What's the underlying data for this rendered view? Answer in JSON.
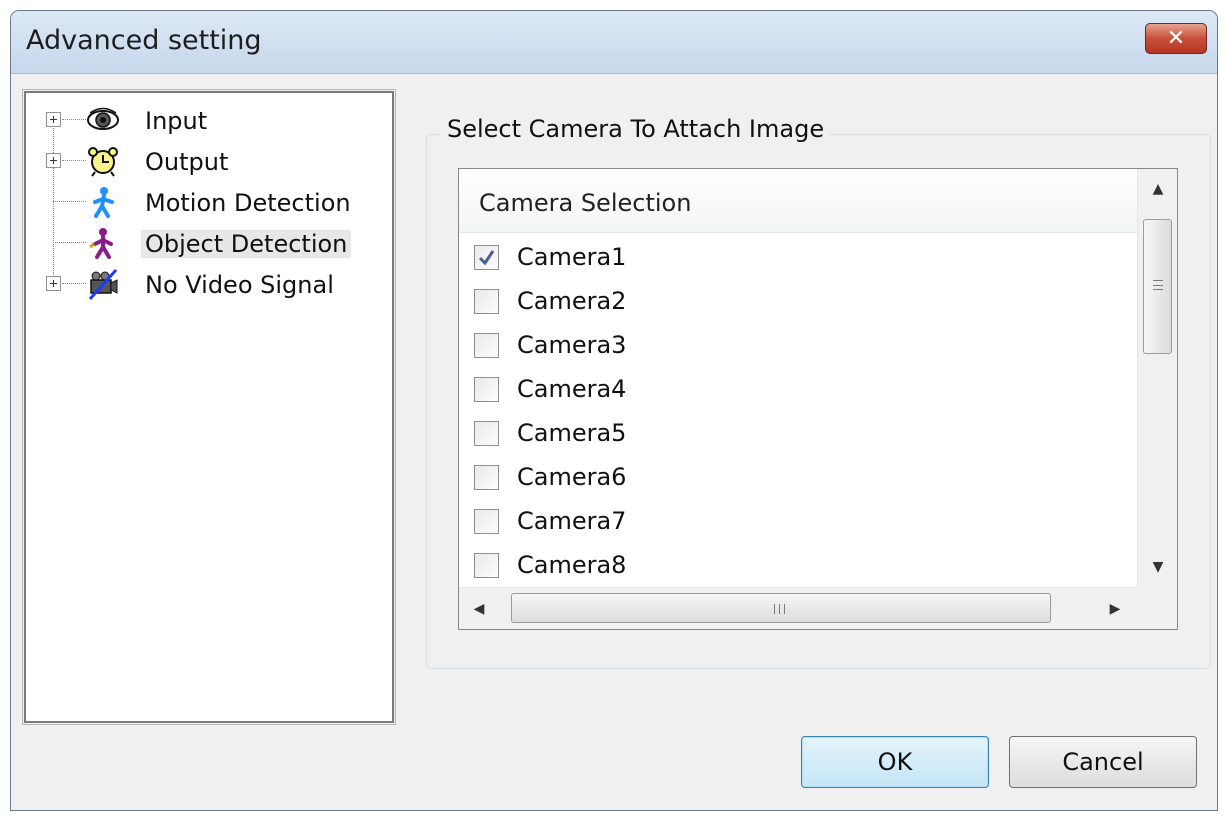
{
  "window": {
    "title": "Advanced setting",
    "close_label": "✕"
  },
  "tree": {
    "items": [
      {
        "label": "Input",
        "icon": "eye-icon",
        "expandable": true
      },
      {
        "label": "Output",
        "icon": "alarm-clock-icon",
        "expandable": true
      },
      {
        "label": "Motion Detection",
        "icon": "running-person-icon",
        "expandable": false
      },
      {
        "label": "Object Detection",
        "icon": "walking-person-icon",
        "expandable": false,
        "selected": true
      },
      {
        "label": "No Video Signal",
        "icon": "no-video-camera-icon",
        "expandable": true
      }
    ]
  },
  "camera_group": {
    "title": "Select Camera To Attach Image",
    "column_header": "Camera Selection",
    "cameras": [
      {
        "name": "Camera1",
        "checked": true
      },
      {
        "name": "Camera2",
        "checked": false
      },
      {
        "name": "Camera3",
        "checked": false
      },
      {
        "name": "Camera4",
        "checked": false
      },
      {
        "name": "Camera5",
        "checked": false
      },
      {
        "name": "Camera6",
        "checked": false
      },
      {
        "name": "Camera7",
        "checked": false
      },
      {
        "name": "Camera8",
        "checked": false
      }
    ]
  },
  "scrollbar": {
    "up": "▲",
    "down": "▼",
    "left": "◀",
    "right": "▶"
  },
  "buttons": {
    "ok_label": "OK",
    "cancel_label": "Cancel"
  },
  "colors": {
    "accent_blue": "#1a8ccf",
    "tree_figure_blue": "#1e90ff",
    "tree_figure_purple": "#8b1a8b"
  }
}
